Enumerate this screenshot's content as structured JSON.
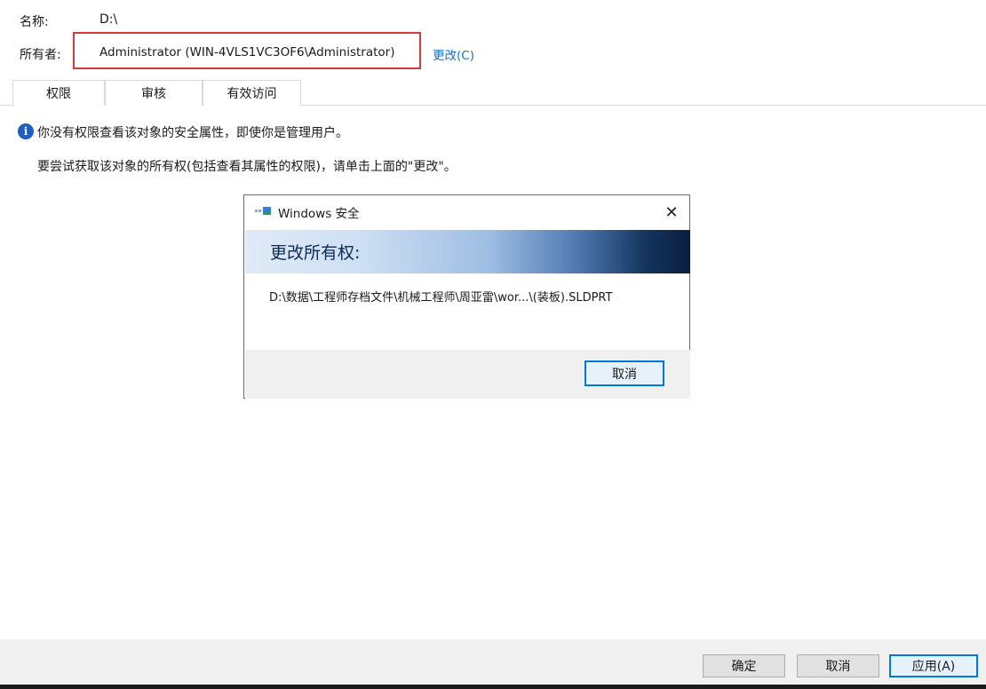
{
  "header": {
    "name_label": "名称:",
    "name_value": "D:\\",
    "owner_label": "所有者:",
    "owner_value": "Administrator (WIN-4VLS1VC3OF6\\Administrator)",
    "change_link": "更改(C)",
    "highlight_color": "#d9383c"
  },
  "tabs": [
    {
      "label": "权限"
    },
    {
      "label": "审核"
    },
    {
      "label": "有效访问"
    }
  ],
  "info": {
    "icon": "info-icon",
    "message": "你没有权限查看该对象的安全属性，即使你是管理用户。",
    "hint": "要尝试获取该对象的所有权(包括查看其属性的权限)，请单击上面的\"更改\"。"
  },
  "dialog": {
    "title": "Windows 安全",
    "close": "✕",
    "heading": "更改所有权:",
    "path": "D:\\数据\\工程师存档文件\\机械工程师\\周亚雷\\wor...\\(装板).SLDPRT",
    "cancel": "取消"
  },
  "footer": {
    "ok": "确定",
    "cancel": "取消",
    "apply": "应用(A)"
  }
}
